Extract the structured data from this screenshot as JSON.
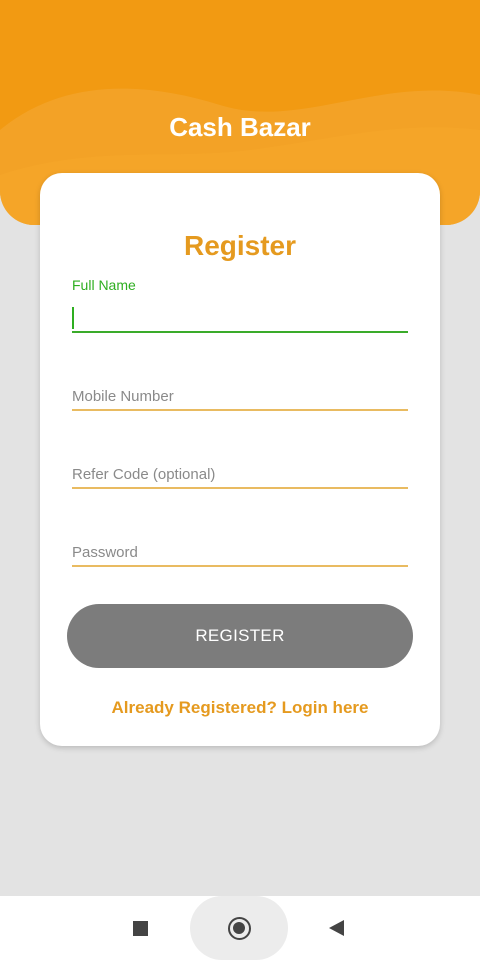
{
  "app": {
    "title": "Cash Bazar"
  },
  "colors": {
    "header": "#f29a12",
    "accent": "#e59a1f",
    "focus": "#2eae20",
    "button": "#7c7c7c"
  },
  "form": {
    "title": "Register",
    "full_name": {
      "label": "Full Name",
      "value": ""
    },
    "mobile": {
      "placeholder": "Mobile Number",
      "value": ""
    },
    "refer_code": {
      "placeholder": "Refer Code (optional)",
      "value": ""
    },
    "password": {
      "placeholder": "Password",
      "value": ""
    },
    "register_label": "REGISTER",
    "login_link": "Already Registered? Login here"
  },
  "navbar": {
    "icons": [
      "square-icon",
      "circle-home-icon",
      "triangle-back-icon"
    ]
  }
}
